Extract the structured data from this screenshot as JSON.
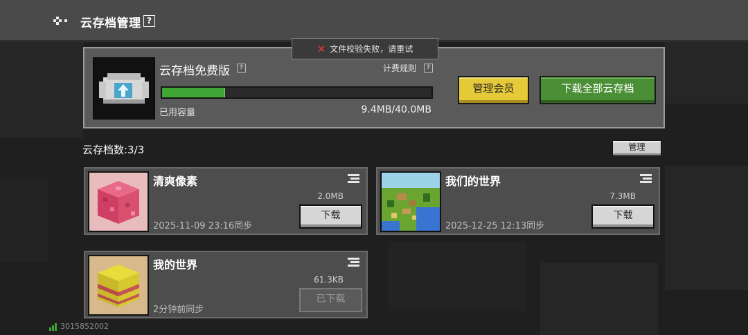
{
  "header": {
    "title": "云存档管理",
    "help": "?"
  },
  "toast": {
    "message": "文件校验失败，请重试"
  },
  "storage": {
    "plan_name": "云存档免费版",
    "help": "?",
    "billing_link": "计费规则",
    "used_label": "已用容量",
    "used_value": "9.4MB/40.0MB",
    "progress": 0.235,
    "manage_member_label": "管理会员",
    "download_all_label": "下载全部云存档"
  },
  "saves": {
    "count_label": "云存档数:3/3",
    "manage_label": "管理",
    "items": [
      {
        "name": "清爽像素",
        "size": "2.0MB",
        "sync": "2025-11-09 23:16同步",
        "button": "下载"
      },
      {
        "name": "我们的世界",
        "size": "7.3MB",
        "sync": "2025-12-25 12:13同步",
        "button": "下载"
      },
      {
        "name": "我的世界",
        "size": "61.3KB",
        "sync": "2分钟前同步",
        "button": "已下载"
      }
    ]
  },
  "footer": {
    "user_id": "3015852002"
  },
  "colors": {
    "accent_green": "#4a8f35",
    "accent_yellow": "#e4c938",
    "error_red": "#e83a3a",
    "progress_green": "#3fa535"
  },
  "icons": [
    "back-icon",
    "help-icon",
    "error-x-icon",
    "cloud-upload-icon",
    "menu-icon",
    "signal-icon"
  ]
}
